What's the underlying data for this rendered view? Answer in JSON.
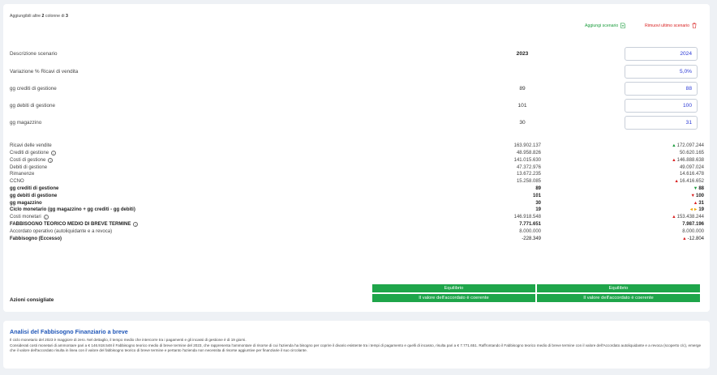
{
  "header": {
    "hint_prefix": "Aggiungibili altre",
    "hint_count": "2",
    "hint_mid": "colonne di",
    "hint_total": "3",
    "add_scenario": "Aggiungi scenario",
    "remove_scenario": "Rimuovi ultimo scenario"
  },
  "scenario": {
    "rows": [
      {
        "label": "Descrizione scenario",
        "v2023": "2023",
        "v2024": "2024"
      },
      {
        "label": "Variazione % Ricavi di vendita",
        "v2023": "",
        "v2024": "5,0%"
      },
      {
        "label": "gg crediti di gestione",
        "v2023": "89",
        "v2024": "88"
      },
      {
        "label": "gg debiti di gestione",
        "v2023": "101",
        "v2024": "100"
      },
      {
        "label": "gg magazzino",
        "v2023": "30",
        "v2024": "31"
      }
    ]
  },
  "table": {
    "rows": [
      {
        "label": "Ricavi delle vendite",
        "v1": "163.902.137",
        "arrow": "▲",
        "v2": "172.097.244"
      },
      {
        "label": "Crediti di gestione",
        "info": "i",
        "v1": "48.958.826",
        "arrow": "",
        "v2": "50.620.165"
      },
      {
        "label": "Costi di gestione",
        "info": "i",
        "v1": "141.015.630",
        "arrow": "▲",
        "v2": "146.888.638"
      },
      {
        "label": "Debiti di gestione",
        "v1": "47.372.976",
        "arrow": "",
        "v2": "49.097.024"
      },
      {
        "label": "Rimanenze",
        "v1": "13.672.235",
        "arrow": "",
        "v2": "14.616.478"
      },
      {
        "label": "CCNO",
        "v1": "15.258.085",
        "arrow": "▲",
        "v2": "16.416.652"
      },
      {
        "label": "gg crediti di gestione",
        "v1": "89",
        "arrow": "▼",
        "v2": "88"
      },
      {
        "label": "gg debiti di gestione",
        "v1": "101",
        "arrow": "▼",
        "v2": "100"
      },
      {
        "label": "gg magazzino",
        "v1": "30",
        "arrow": "▲",
        "v2": "31"
      },
      {
        "label": "Ciclo monetario (gg magazzino + gg crediti - gg debiti)",
        "v1": "19",
        "arrow": "◄►",
        "v2": "19"
      },
      {
        "label": "Costi monetari",
        "info": "i",
        "v1": "146.918.548",
        "arrow": "▲",
        "v2": "153.438.244"
      },
      {
        "label": "FABBISOGNO TEORICO MEDIO DI BREVE TERMINE",
        "info": "i",
        "v1": "7.771.651",
        "arrow": "",
        "v2": "7.987.196"
      },
      {
        "label": "Accordato operativo (autoliquidante e a revoca)",
        "v1": "8.000.000",
        "arrow": "",
        "v2": "8.000.000"
      },
      {
        "label": "Fabbisogno (Eccesso)",
        "v1": "-228.349",
        "arrow": "▲",
        "v2": "-12.804"
      }
    ]
  },
  "actions": {
    "label": "Azioni consigliate",
    "c1_status": "Equilibrio",
    "c1_message": "Il valore dell'accordato è coerente",
    "c2_status": "Equilibrio",
    "c2_message": "Il valore dell'accordato è coerente"
  },
  "analysis": {
    "title": "Analisi del Fabbisogno Finanziario a breve",
    "p1": "Il ciclo monetario del 2023 è maggiore di zero. Nel dettaglio, il tempo medio che intercorre tra i pagamenti e gli incassi di gestione è di 19 giorni.",
    "p2": "Considerati costi monetari di ammontare pari a € 146.918.548 il Fabbisogno teorico medio di breve termine del 2023, che rappresenta l'ammontare di risorse di cui l'azienda ha bisogno per coprire il divario esistente tra i tempi di pagamento e quelli di incasso, risulta pari a € 7.771.651. Raffrontando il Fabbisogno teorico medio di breve termine con il valore dell'Accordato autoliquidante e a revoca (scoperto c/c), emerge che il valore dell'accordato risulta in linea con il valore del fabbisogno teorico di breve termine e pertanto l'azienda non necessita di risorse aggiuntive per finanziarie il suo circolante."
  },
  "colors": {
    "green": "#1ea54a",
    "red": "#d92020",
    "blue": "#1f56b8",
    "yellow": "#f0a500"
  },
  "icons": [
    "add-document-icon",
    "trash-icon",
    "info-icon",
    "arrow-up-icon",
    "arrow-down-icon",
    "arrow-left-right-icon"
  ]
}
